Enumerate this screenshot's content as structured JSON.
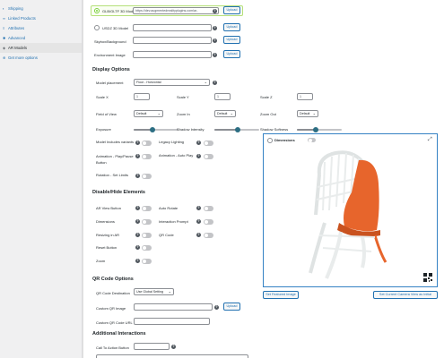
{
  "sidebar": {
    "items": [
      {
        "label": "Shipping",
        "icon": "truck-icon"
      },
      {
        "label": "Linked Products",
        "icon": "link-icon"
      },
      {
        "label": "Attributes",
        "icon": "list-icon"
      },
      {
        "label": "Advanced",
        "icon": "gear-icon"
      },
      {
        "label": "AR Models",
        "icon": "cube-icon",
        "active": true
      },
      {
        "label": "Get more options",
        "icon": "plus-icon"
      }
    ]
  },
  "models": {
    "gltf_label": "GLB/GLTF 3D Model",
    "gltf_url": "https://dev.augmentedrealityplugins.com/ar-",
    "usdz_label": "USDZ 3D Model",
    "usdz_url": "",
    "skybox_label": "Skybox/Background",
    "environment_label": "Environment Image",
    "upload_label": "Upload"
  },
  "display_options": {
    "heading": "Display Options",
    "model_placement_label": "Model placement",
    "model_placement_value": "Floor - Horizontal",
    "scale_x_label": "Scale X",
    "scale_x": "1",
    "scale_y_label": "Scale Y",
    "scale_y": "1",
    "scale_z_label": "Scale Z",
    "scale_z": "1",
    "fov_label": "Field of View",
    "fov_value": "Default",
    "zoom_in_label": "Zoom In",
    "zoom_in_value": "Default",
    "zoom_out_label": "Zoom Out",
    "zoom_out_value": "Default",
    "exposure_label": "Exposure",
    "exposure_level": 0.42,
    "shadow_intensity_label": "Shadow Intensity",
    "shadow_intensity_level": 0.52,
    "shadow_softness_label": "Shadow Softness",
    "shadow_softness_level": 0.42,
    "model_variants_label": "Model Includes variants",
    "legacy_lighting_label": "Legacy Lighting",
    "animation_play_label": "Animation - Play/Pause Button",
    "animation_auto_label": "Animation - Auto Play",
    "rotation_label": "Rotation - Set Limits"
  },
  "disable_hide": {
    "heading": "Disable/Hide Elements",
    "ar_view_button": "AR View Button",
    "auto_rotate": "Auto Rotate",
    "dimensions": "Dimensions",
    "interaction_prompt": "Interaction Prompt",
    "resizing_in_ar": "Resizing in AR",
    "qr_code": "QR Code",
    "reset_button": "Reset Button",
    "zoom": "Zoom"
  },
  "qr_options": {
    "heading": "QR Code Options",
    "destination_label": "QR Code Destination",
    "destination_value": "Use Global Setting",
    "custom_image_label": "Custom QR Image",
    "custom_url_label": "Custom QR Code URL"
  },
  "additional": {
    "heading": "Additional Interactions",
    "cta_label": "Call To Action Button"
  },
  "preview": {
    "dimensions_label": "Dimensions",
    "set_featured_label": "Set Featured Image",
    "set_camera_label": "Set Current Camera View as Initial"
  },
  "colors": {
    "accent": "#2271b1",
    "chair_seat": "#e7652c",
    "chair_frame": "#e9ecec",
    "slider_knob": "#2c6e83"
  }
}
